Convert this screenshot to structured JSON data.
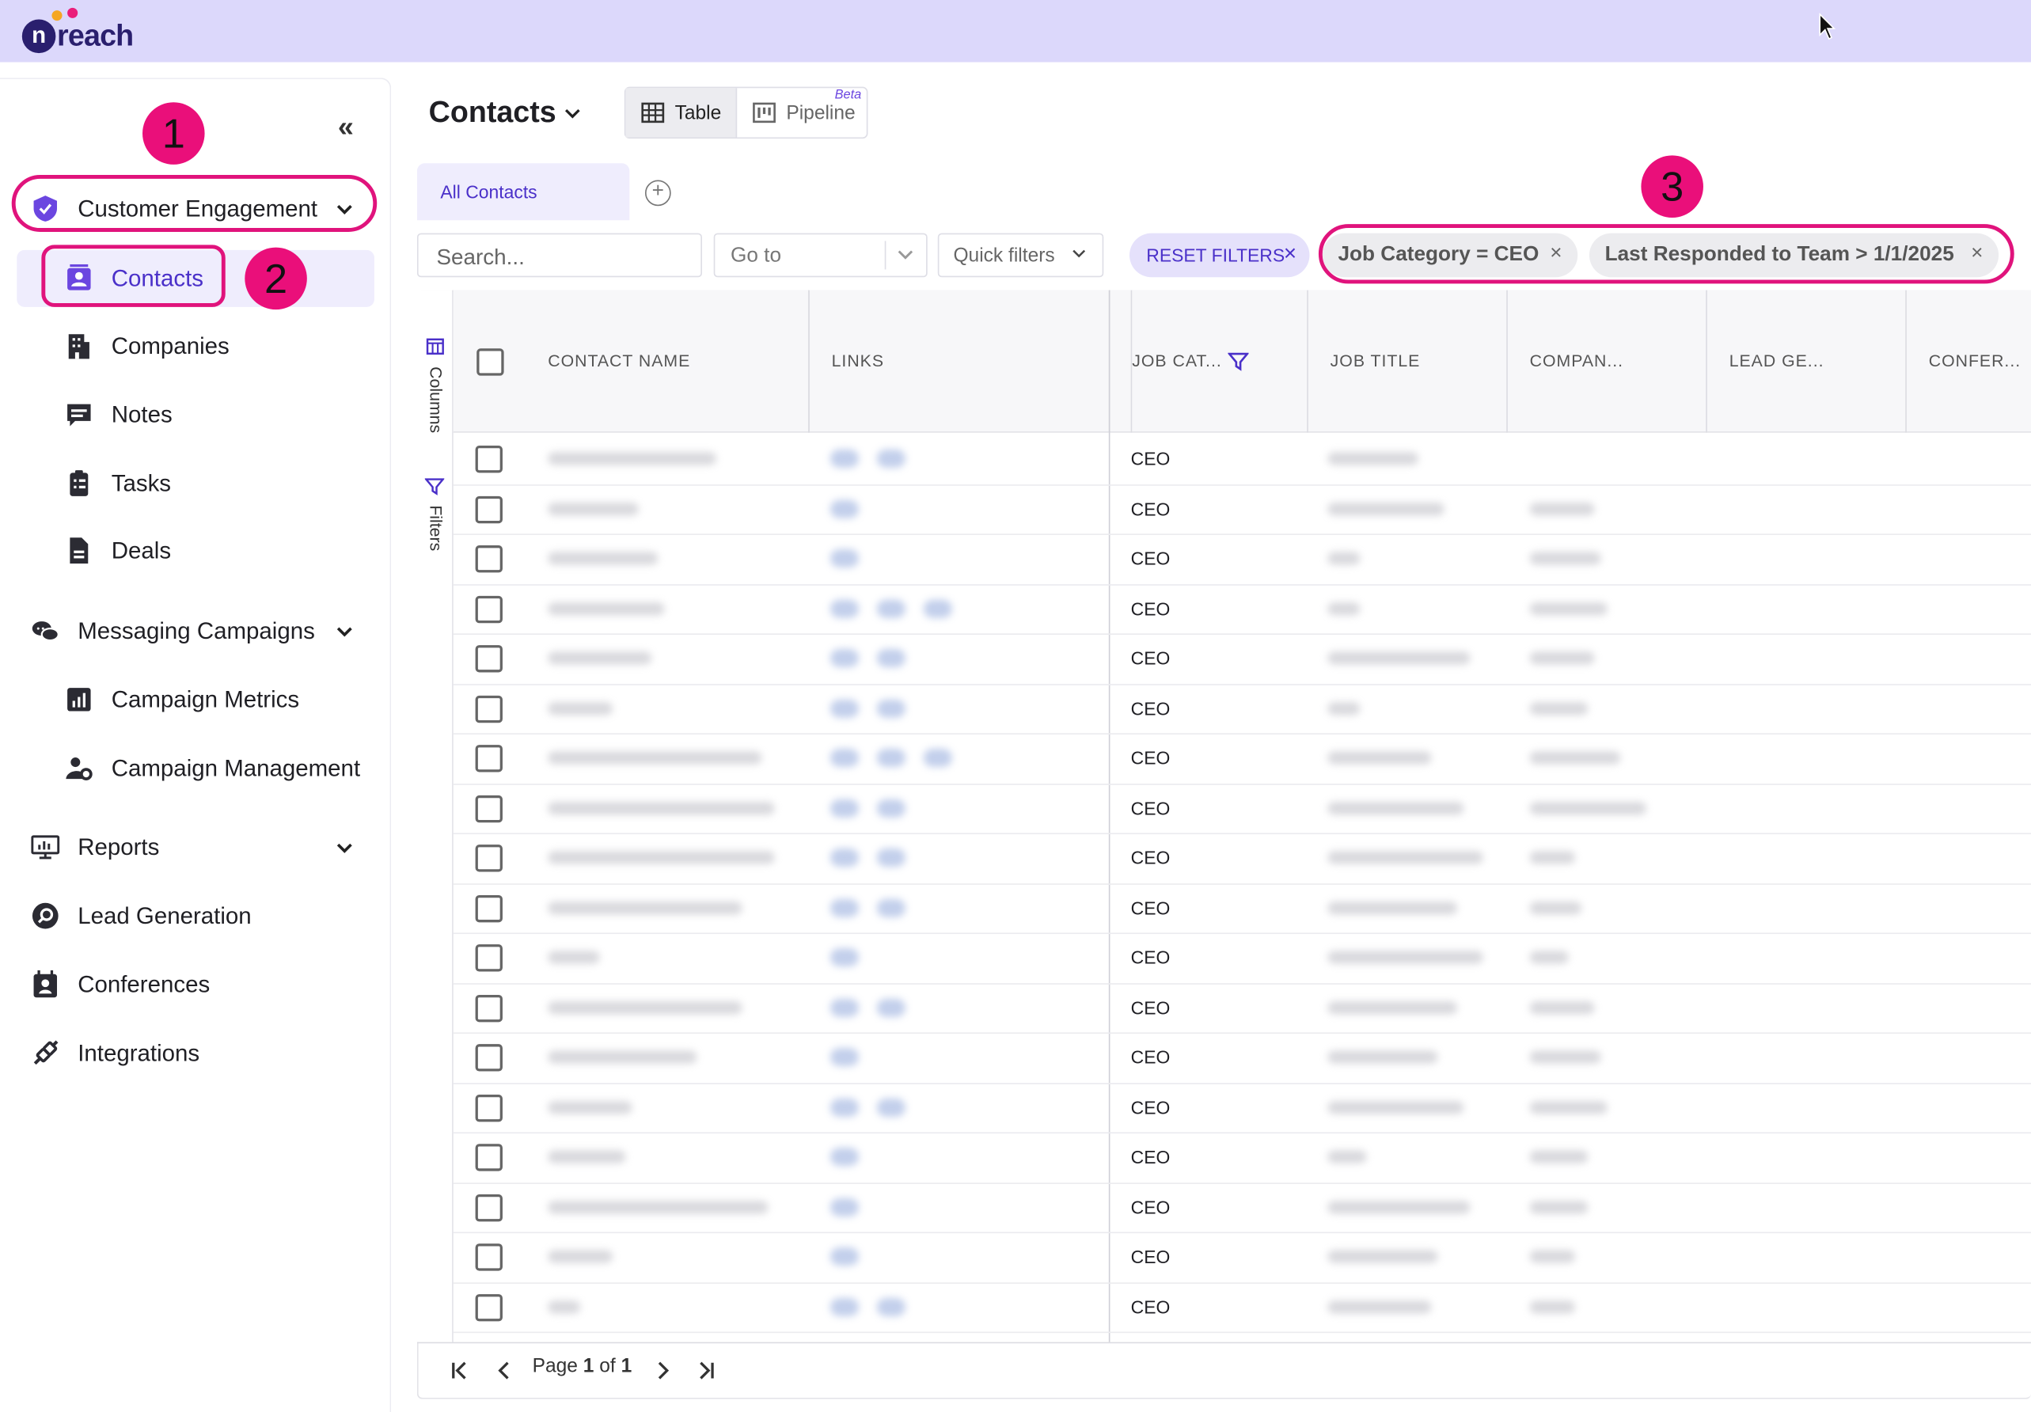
{
  "app": {
    "logo_text": "reach",
    "logo_letter": "n"
  },
  "sidebar": {
    "collapse_label": "«",
    "items": [
      {
        "label": "Customer Engagement"
      },
      {
        "label": "Contacts"
      },
      {
        "label": "Companies"
      },
      {
        "label": "Notes"
      },
      {
        "label": "Tasks"
      },
      {
        "label": "Deals"
      },
      {
        "label": "Messaging Campaigns"
      },
      {
        "label": "Campaign Metrics"
      },
      {
        "label": "Campaign Management"
      },
      {
        "label": "Reports"
      },
      {
        "label": "Lead Generation"
      },
      {
        "label": "Conferences"
      },
      {
        "label": "Integrations"
      }
    ]
  },
  "annotations": {
    "one": "1",
    "two": "2",
    "three": "3"
  },
  "main": {
    "title": "Contacts",
    "view_table": "Table",
    "view_pipeline": "Pipeline",
    "beta_label": "Beta",
    "tab_all": "All Contacts",
    "add_tab": "+"
  },
  "toolbar": {
    "search_placeholder": "Search...",
    "goto_label": "Go to",
    "quick_filters": "Quick filters",
    "reset_filters": "RESET FILTERS",
    "chip_1": "Job Category = CEO",
    "chip_2": "Last Responded to Team > 1/1/2025",
    "chip_close": "×"
  },
  "grid": {
    "side_columns": "Columns",
    "side_filters": "Filters",
    "headers": [
      "CONTACT NAME",
      "LINKS",
      "JOB CAT...",
      "JOB TITLE",
      "COMPAN...",
      "LEAD GE...",
      "CONFER..."
    ],
    "rows": [
      "CEO",
      "CEO",
      "CEO",
      "CEO",
      "CEO",
      "CEO",
      "CEO",
      "CEO",
      "CEO",
      "CEO",
      "CEO",
      "CEO",
      "CEO",
      "CEO",
      "CEO",
      "CEO",
      "CEO",
      "CEO"
    ]
  },
  "pagination": {
    "page_word": "Page",
    "current": "1",
    "of_word": "of",
    "total": "1"
  },
  "colors": {
    "accent": "#4a30c9",
    "annotation": "#e0137c",
    "topbar": "#dcd8fb"
  }
}
